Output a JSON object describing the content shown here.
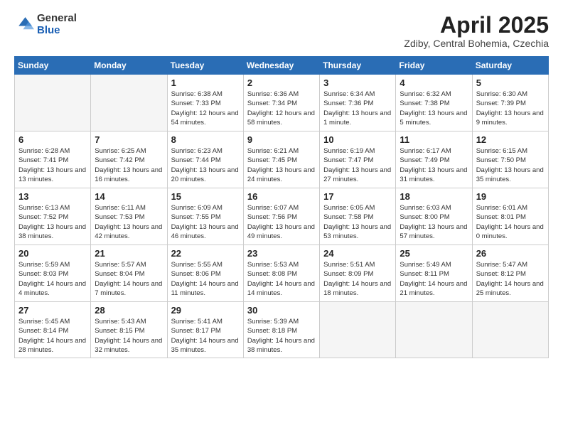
{
  "logo": {
    "general": "General",
    "blue": "Blue"
  },
  "header": {
    "month": "April 2025",
    "location": "Zdiby, Central Bohemia, Czechia"
  },
  "weekdays": [
    "Sunday",
    "Monday",
    "Tuesday",
    "Wednesday",
    "Thursday",
    "Friday",
    "Saturday"
  ],
  "days": [
    {
      "date": "",
      "info": ""
    },
    {
      "date": "",
      "info": ""
    },
    {
      "date": "1",
      "sunrise": "6:38 AM",
      "sunset": "7:33 PM",
      "daylight": "12 hours and 54 minutes."
    },
    {
      "date": "2",
      "sunrise": "6:36 AM",
      "sunset": "7:34 PM",
      "daylight": "12 hours and 58 minutes."
    },
    {
      "date": "3",
      "sunrise": "6:34 AM",
      "sunset": "7:36 PM",
      "daylight": "13 hours and 1 minute."
    },
    {
      "date": "4",
      "sunrise": "6:32 AM",
      "sunset": "7:38 PM",
      "daylight": "13 hours and 5 minutes."
    },
    {
      "date": "5",
      "sunrise": "6:30 AM",
      "sunset": "7:39 PM",
      "daylight": "13 hours and 9 minutes."
    },
    {
      "date": "6",
      "sunrise": "6:28 AM",
      "sunset": "7:41 PM",
      "daylight": "13 hours and 13 minutes."
    },
    {
      "date": "7",
      "sunrise": "6:25 AM",
      "sunset": "7:42 PM",
      "daylight": "13 hours and 16 minutes."
    },
    {
      "date": "8",
      "sunrise": "6:23 AM",
      "sunset": "7:44 PM",
      "daylight": "13 hours and 20 minutes."
    },
    {
      "date": "9",
      "sunrise": "6:21 AM",
      "sunset": "7:45 PM",
      "daylight": "13 hours and 24 minutes."
    },
    {
      "date": "10",
      "sunrise": "6:19 AM",
      "sunset": "7:47 PM",
      "daylight": "13 hours and 27 minutes."
    },
    {
      "date": "11",
      "sunrise": "6:17 AM",
      "sunset": "7:49 PM",
      "daylight": "13 hours and 31 minutes."
    },
    {
      "date": "12",
      "sunrise": "6:15 AM",
      "sunset": "7:50 PM",
      "daylight": "13 hours and 35 minutes."
    },
    {
      "date": "13",
      "sunrise": "6:13 AM",
      "sunset": "7:52 PM",
      "daylight": "13 hours and 38 minutes."
    },
    {
      "date": "14",
      "sunrise": "6:11 AM",
      "sunset": "7:53 PM",
      "daylight": "13 hours and 42 minutes."
    },
    {
      "date": "15",
      "sunrise": "6:09 AM",
      "sunset": "7:55 PM",
      "daylight": "13 hours and 46 minutes."
    },
    {
      "date": "16",
      "sunrise": "6:07 AM",
      "sunset": "7:56 PM",
      "daylight": "13 hours and 49 minutes."
    },
    {
      "date": "17",
      "sunrise": "6:05 AM",
      "sunset": "7:58 PM",
      "daylight": "13 hours and 53 minutes."
    },
    {
      "date": "18",
      "sunrise": "6:03 AM",
      "sunset": "8:00 PM",
      "daylight": "13 hours and 57 minutes."
    },
    {
      "date": "19",
      "sunrise": "6:01 AM",
      "sunset": "8:01 PM",
      "daylight": "14 hours and 0 minutes."
    },
    {
      "date": "20",
      "sunrise": "5:59 AM",
      "sunset": "8:03 PM",
      "daylight": "14 hours and 4 minutes."
    },
    {
      "date": "21",
      "sunrise": "5:57 AM",
      "sunset": "8:04 PM",
      "daylight": "14 hours and 7 minutes."
    },
    {
      "date": "22",
      "sunrise": "5:55 AM",
      "sunset": "8:06 PM",
      "daylight": "14 hours and 11 minutes."
    },
    {
      "date": "23",
      "sunrise": "5:53 AM",
      "sunset": "8:08 PM",
      "daylight": "14 hours and 14 minutes."
    },
    {
      "date": "24",
      "sunrise": "5:51 AM",
      "sunset": "8:09 PM",
      "daylight": "14 hours and 18 minutes."
    },
    {
      "date": "25",
      "sunrise": "5:49 AM",
      "sunset": "8:11 PM",
      "daylight": "14 hours and 21 minutes."
    },
    {
      "date": "26",
      "sunrise": "5:47 AM",
      "sunset": "8:12 PM",
      "daylight": "14 hours and 25 minutes."
    },
    {
      "date": "27",
      "sunrise": "5:45 AM",
      "sunset": "8:14 PM",
      "daylight": "14 hours and 28 minutes."
    },
    {
      "date": "28",
      "sunrise": "5:43 AM",
      "sunset": "8:15 PM",
      "daylight": "14 hours and 32 minutes."
    },
    {
      "date": "29",
      "sunrise": "5:41 AM",
      "sunset": "8:17 PM",
      "daylight": "14 hours and 35 minutes."
    },
    {
      "date": "30",
      "sunrise": "5:39 AM",
      "sunset": "8:18 PM",
      "daylight": "14 hours and 38 minutes."
    },
    {
      "date": "",
      "info": ""
    },
    {
      "date": "",
      "info": ""
    },
    {
      "date": "",
      "info": ""
    }
  ]
}
